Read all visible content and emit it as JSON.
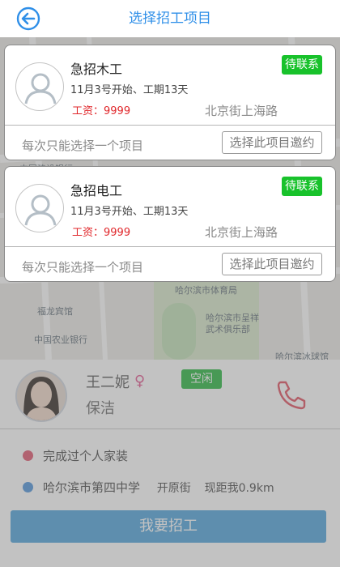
{
  "header": {
    "back_icon": "back-arrow-circle-icon",
    "title": "选择招工项目"
  },
  "accent_color": "#2f8fe8",
  "jobs": [
    {
      "title": "急招木工",
      "badge": "待联系",
      "schedule": "11月3号开始、工期13天",
      "wage": "工资：9999",
      "location": "北京街上海路",
      "hint": "每次只能选择一个项目",
      "select_label": "选择此项目邀约"
    },
    {
      "title": "急招电工",
      "badge": "待联系",
      "schedule": "11月3号开始、工期13天",
      "wage": "工资：9999",
      "location": "北京街上海路",
      "hint": "每次只能选择一个项目",
      "select_label": "选择此项目邀约"
    }
  ],
  "map": {
    "labels": [
      "中国建设银行",
      "哈尔滨市体育局",
      "福龙宾馆",
      "哈尔滨市呈祥",
      "武术俱乐部",
      "中国农业银行",
      "哈尔滨冰球馆"
    ]
  },
  "worker": {
    "name": "王二妮",
    "gender_icon": "female-icon",
    "status": "空闲",
    "skill": "保洁",
    "phone_icon": "phone-icon",
    "experience": "完成过个人家装",
    "school": "哈尔滨市第四中学",
    "street": "开原街",
    "distance": "现距我0.9km"
  },
  "hire_button": "我要招工",
  "colors": {
    "badge_green": "#18c22b",
    "wage_red": "#e0262a",
    "dot_red": "#e0506a",
    "dot_blue": "#4a90d9"
  }
}
